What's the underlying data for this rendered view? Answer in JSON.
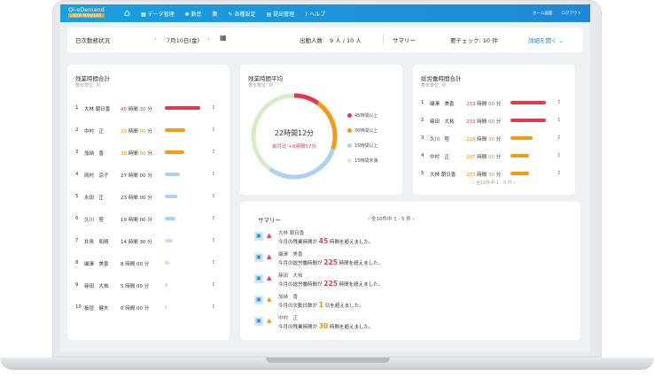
{
  "app": {
    "logo_text": "Qi-eDemand",
    "logo_sub": "LABOR MANAGER",
    "nav": [
      "データ管理",
      "勤怠",
      "集",
      "各種設定",
      "提出管理",
      "ヘルプ"
    ],
    "top_right": [
      "ホーム画面",
      "ログアウト"
    ]
  },
  "header": {
    "title": "日次勤務状況",
    "date": "7月10日(金)",
    "attendance_label": "出勤人数",
    "attendance_value": "9 人 / 10 人",
    "summary_label": "サマリー",
    "check_label": "要チェック: 10 件",
    "details_link": "詳細を開く"
  },
  "overtime": {
    "title": "残業時間合計",
    "unit": "表示単位: 月",
    "rows": [
      {
        "rank": "1",
        "name": "大林 朝日香",
        "h": "45",
        "hu": "時間",
        "m": "30",
        "mu": "分",
        "level": 0.95,
        "color": "#e03a50",
        "tone": "red"
      },
      {
        "rank": "2",
        "name": "中村　正",
        "h": "39",
        "hu": "時間",
        "m": "00",
        "mu": "分",
        "level": 0.55,
        "color": "#f59a12",
        "tone": "org"
      },
      {
        "rank": "3",
        "name": "加納　香",
        "h": "38",
        "hu": "時間",
        "m": "00",
        "mu": "分",
        "level": 0.53,
        "color": "#f59a12",
        "tone": "org"
      },
      {
        "rank": "4",
        "name": "岡村　涼子",
        "h": "27",
        "hu": "時間",
        "m": "00",
        "mu": "分",
        "level": 0.4,
        "color": "#a9d3ef",
        "tone": ""
      },
      {
        "rank": "5",
        "name": "永田　正",
        "h": "23",
        "hu": "時間",
        "m": "00",
        "mu": "分",
        "level": 0.34,
        "color": "#a9d3ef",
        "tone": ""
      },
      {
        "rank": "6",
        "name": "久川　陸",
        "h": "19",
        "hu": "時間",
        "m": "00",
        "mu": "分",
        "level": 0.28,
        "color": "#a9d3ef",
        "tone": ""
      },
      {
        "rank": "7",
        "name": "井鳥　和晴",
        "h": "14",
        "hu": "時間",
        "m": "30",
        "mu": "分",
        "level": 0.21,
        "color": "#c8e6c0",
        "tone": ""
      },
      {
        "rank": "8",
        "name": "磯澤　美香",
        "h": "8",
        "hu": "時間",
        "m": "00",
        "mu": "分",
        "level": 0.12,
        "color": "#c8e6c0",
        "tone": ""
      },
      {
        "rank": "9",
        "name": "篠田　大祐",
        "h": "5",
        "hu": "時間",
        "m": "00",
        "mu": "分",
        "level": 0.08,
        "color": "#c8e6c0",
        "tone": ""
      },
      {
        "rank": "10",
        "name": "板垣　健夫",
        "h": "0",
        "hu": "時間",
        "m": "00",
        "mu": "分",
        "level": 0.01,
        "color": "#c8e6c0",
        "tone": ""
      }
    ]
  },
  "average": {
    "title": "残業時間平均",
    "unit": "表示単位: 月",
    "center": "22時間12分",
    "delta": "前月比 +6時間57分",
    "legend": [
      {
        "label": "45時間以上",
        "color": "#e03a50"
      },
      {
        "label": "30時間以上",
        "color": "#f59a12"
      },
      {
        "label": "15時間以上",
        "color": "#a9d3ef"
      },
      {
        "label": "15時間未満",
        "color": "#d8ecc6"
      }
    ],
    "segments": [
      {
        "value": 0.1,
        "color": "#e03a50"
      },
      {
        "value": 0.2,
        "color": "#f59a12"
      },
      {
        "value": 0.3,
        "color": "#a9d3ef"
      },
      {
        "value": 0.4,
        "color": "#d8ecc6"
      }
    ]
  },
  "total": {
    "title": "総労働時間合計",
    "unit": "表示単位: 月",
    "rows": [
      {
        "rank": "1",
        "name": "磯澤　美香",
        "h": "233",
        "hu": "時間",
        "m": "00",
        "mu": "分",
        "level": 0.95,
        "color": "#e03a50",
        "tone": "red"
      },
      {
        "rank": "2",
        "name": "篠田　大祐",
        "h": "233",
        "hu": "時間",
        "m": "00",
        "mu": "分",
        "level": 0.95,
        "color": "#e03a50",
        "tone": "red"
      },
      {
        "rank": "3",
        "name": "久川　陸",
        "h": "228",
        "hu": "時間",
        "m": "30",
        "mu": "分",
        "level": 0.6,
        "color": "#f59a12",
        "tone": "org"
      },
      {
        "rank": "4",
        "name": "中村　正",
        "h": "207",
        "hu": "時間",
        "m": "00",
        "mu": "分",
        "level": 0.5,
        "color": "#f59a12",
        "tone": "org"
      },
      {
        "rank": "5",
        "name": "大林 朝日香",
        "h": "207",
        "hu": "時間",
        "m": "30",
        "mu": "分",
        "level": 0.5,
        "color": "#f59a12",
        "tone": "org"
      }
    ],
    "pager": "全10件中 1 - 5 件"
  },
  "summary": {
    "title": "サマリー",
    "pager": "全10件中 1 - 5 件",
    "items": [
      {
        "name": "大林 朝日香",
        "pre": "今月の残業時間が",
        "num": "45",
        "post": "時間を超えました。",
        "tone": "red",
        "warn": "red"
      },
      {
        "name": "磯澤　美香",
        "pre": "今月の総労働時間が",
        "num": "225",
        "post": "時間を超えました。",
        "tone": "red",
        "warn": "red"
      },
      {
        "name": "篠田　大祐",
        "pre": "今月の総労働時間が",
        "num": "225",
        "post": "時間を超えました。",
        "tone": "red",
        "warn": "red"
      },
      {
        "name": "加納　香",
        "pre": "今月の欠勤日数が",
        "num": "1",
        "post": "日を超えました。",
        "tone": "org",
        "warn": "org"
      },
      {
        "name": "中村　正",
        "pre": "今月の残業時間が",
        "num": "30",
        "post": "時間を超えました。",
        "tone": "org",
        "warn": "org"
      }
    ]
  }
}
